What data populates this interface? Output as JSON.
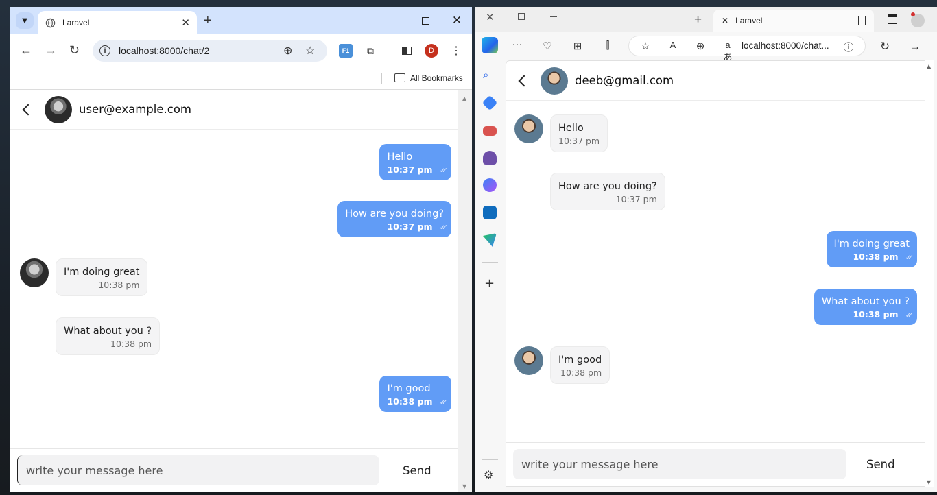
{
  "chrome": {
    "tab_title": "Laravel",
    "url": "localhost:8000/chat/2",
    "profile_initial": "D",
    "bookmarks_label": "All Bookmarks"
  },
  "edge": {
    "tab_title": "Laravel",
    "url": "localhost:8000/chat..."
  },
  "chat_left": {
    "contact": "user@example.com",
    "messages": [
      {
        "text": "Hello",
        "time": "10:37 pm",
        "dir": "out"
      },
      {
        "text": "How are you doing?",
        "time": "10:37 pm",
        "dir": "out"
      },
      {
        "text": "I'm doing great",
        "time": "10:38 pm",
        "dir": "in"
      },
      {
        "text": "What about you ?",
        "time": "10:38 pm",
        "dir": "in"
      },
      {
        "text": "I'm good",
        "time": "10:38 pm",
        "dir": "out"
      }
    ],
    "input_placeholder": "write your message here",
    "send_label": "Send"
  },
  "chat_right": {
    "contact": "deeb@gmail.com",
    "messages": [
      {
        "text": "Hello",
        "time": "10:37 pm",
        "dir": "in"
      },
      {
        "text": "How are you doing?",
        "time": "10:37 pm",
        "dir": "in"
      },
      {
        "text": "I'm doing great",
        "time": "10:38 pm",
        "dir": "out"
      },
      {
        "text": "What about you ?",
        "time": "10:38 pm",
        "dir": "out"
      },
      {
        "text": "I'm good",
        "time": "10:38 pm",
        "dir": "in"
      }
    ],
    "input_placeholder": "write your message here",
    "send_label": "Send"
  },
  "colors": {
    "outgoing_bubble": "#619cf6",
    "incoming_bubble": "#f4f4f5",
    "chrome_tabbar": "#d3e3fd"
  }
}
